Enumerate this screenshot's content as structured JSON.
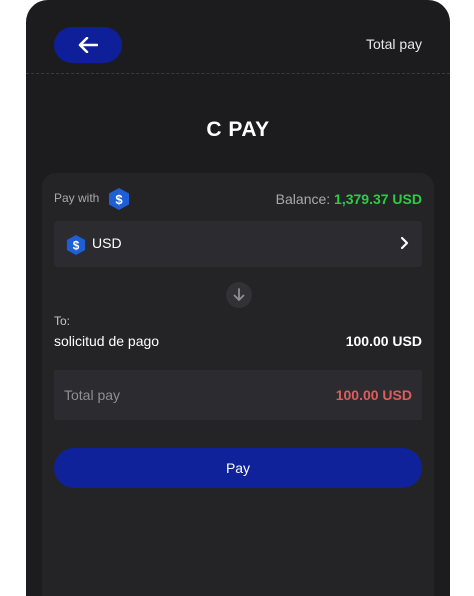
{
  "header": {
    "back_icon": "arrow-left-icon",
    "title": "Total pay"
  },
  "app": {
    "title": "C PAY"
  },
  "payment": {
    "pay_with_label": "Pay with",
    "pay_with_icon": "dollar-hex-icon",
    "balance_label": "Balance:",
    "balance_value": "1,379.37 USD",
    "currency": {
      "icon": "dollar-hex-icon",
      "label": "USD",
      "chevron_icon": "chevron-right-icon"
    },
    "direction_icon": "arrow-down-icon",
    "to_label": "To:",
    "recipient": "solicitud de pago",
    "amount": "100.00 USD",
    "total_label": "Total pay",
    "total_value": "100.00 USD",
    "pay_button_label": "Pay"
  },
  "colors": {
    "background": "#1c1c1e",
    "card": "#242427",
    "accent": "#10229a",
    "balance": "#2ecc40",
    "total": "#e05c5c"
  }
}
